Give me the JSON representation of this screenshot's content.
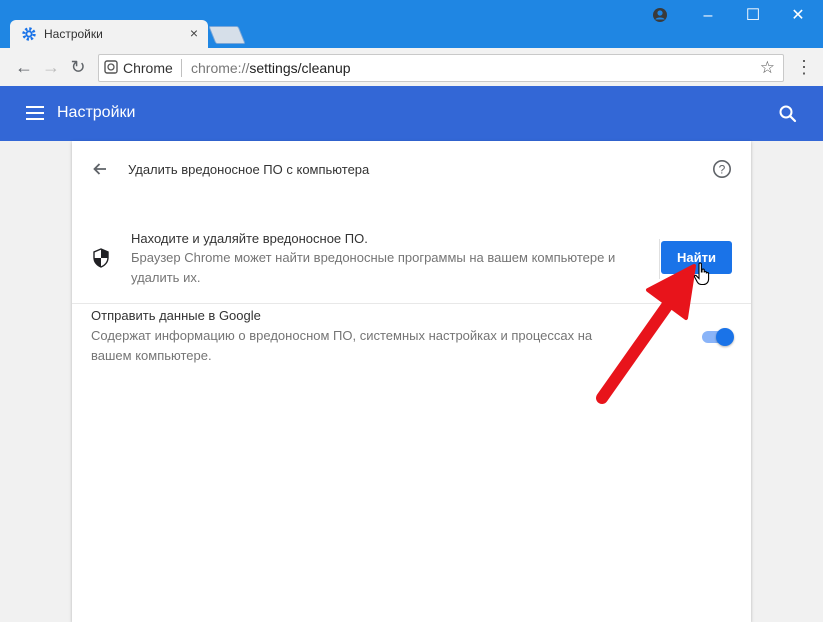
{
  "tab": {
    "title": "Настройки",
    "close": "×"
  },
  "window_controls": {
    "minimize": "–",
    "maximize": "☐",
    "close": "✕"
  },
  "omnibox": {
    "site_label": "Chrome",
    "url_prefix": "chrome://",
    "url_main": "settings/cleanup"
  },
  "header": {
    "title": "Настройки"
  },
  "page": {
    "title": "Удалить вредоносное ПО с компьютера",
    "find_section": {
      "title": "Находите и удаляйте вредоносное ПО.",
      "description": "Браузер Chrome может найти вредоносные программы на вашем компьютере и удалить их.",
      "button_label": "Найти"
    },
    "report_section": {
      "title": "Отправить данные в Google",
      "description": "Содержат информацию о вредоносном ПО, системных настройках и процессах на вашем компьютере.",
      "toggle_on": true
    }
  },
  "colors": {
    "titlebar": "#1f86e3",
    "header": "#3367d6",
    "accent": "#1a73e8",
    "annotation_arrow": "#e8141b"
  }
}
